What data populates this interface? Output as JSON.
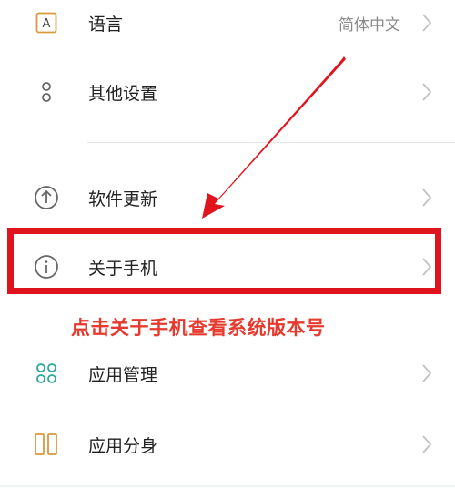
{
  "settings": {
    "items": [
      {
        "label": "语言",
        "value": "简体中文",
        "icon": "language-icon"
      },
      {
        "label": "其他设置",
        "value": "",
        "icon": "more-settings-icon"
      },
      {
        "label": "软件更新",
        "value": "",
        "icon": "update-icon"
      },
      {
        "label": "关于手机",
        "value": "",
        "icon": "info-icon"
      },
      {
        "label": "应用管理",
        "value": "",
        "icon": "app-management-icon"
      },
      {
        "label": "应用分身",
        "value": "",
        "icon": "app-clone-icon"
      }
    ]
  },
  "annotation": {
    "text": "点击关于手机查看系统版本号",
    "color": "#e63a2e",
    "box_color": "#e0141c"
  },
  "colors": {
    "icon_orange": "#d99a3c",
    "icon_gray": "#666666",
    "icon_teal": "#2aa89a",
    "chevron": "#c2c2c2"
  }
}
